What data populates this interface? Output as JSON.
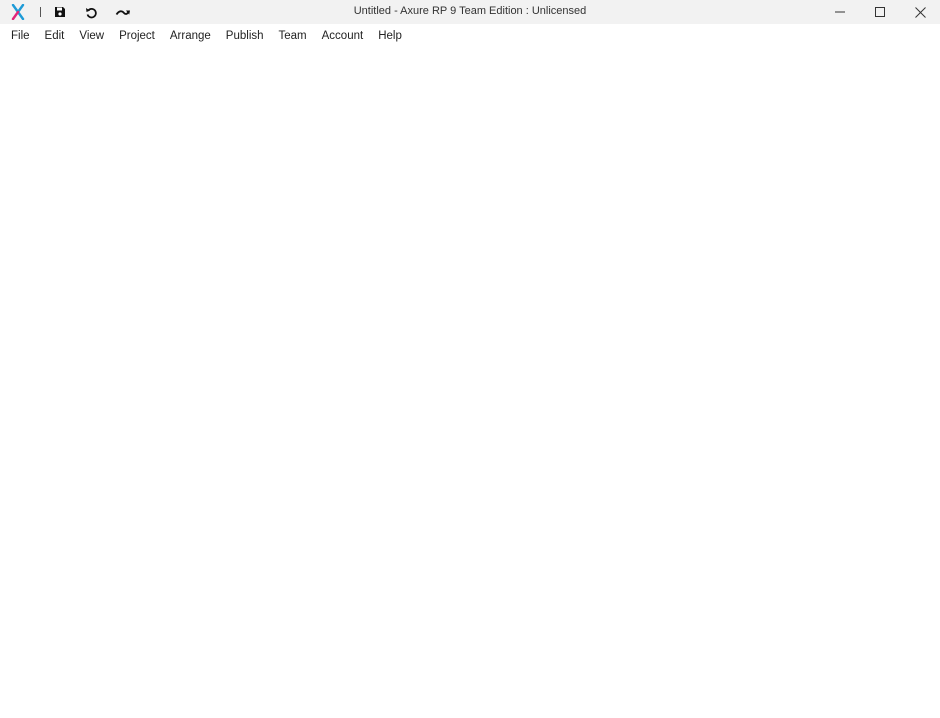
{
  "window": {
    "title": "Untitled - Axure RP 9 Team Edition : Unlicensed",
    "logo_icon": "axure-logo-icon",
    "quick_access": [
      {
        "name": "save",
        "icon": "save-icon"
      },
      {
        "name": "undo",
        "icon": "undo-icon"
      },
      {
        "name": "redo",
        "icon": "redo-icon"
      }
    ],
    "controls": [
      {
        "name": "minimize",
        "icon": "minimize-icon"
      },
      {
        "name": "maximize",
        "icon": "maximize-icon"
      },
      {
        "name": "close",
        "icon": "close-icon"
      }
    ],
    "colors": {
      "titlebar_bg": "#f2f2f2",
      "logo_blue": "#1e9bd7",
      "logo_pink": "#e2257a",
      "body_bg": "#ffffff"
    }
  },
  "menu": {
    "items": [
      {
        "label": "File"
      },
      {
        "label": "Edit"
      },
      {
        "label": "View"
      },
      {
        "label": "Project"
      },
      {
        "label": "Arrange"
      },
      {
        "label": "Publish"
      },
      {
        "label": "Team"
      },
      {
        "label": "Account"
      },
      {
        "label": "Help"
      }
    ]
  }
}
